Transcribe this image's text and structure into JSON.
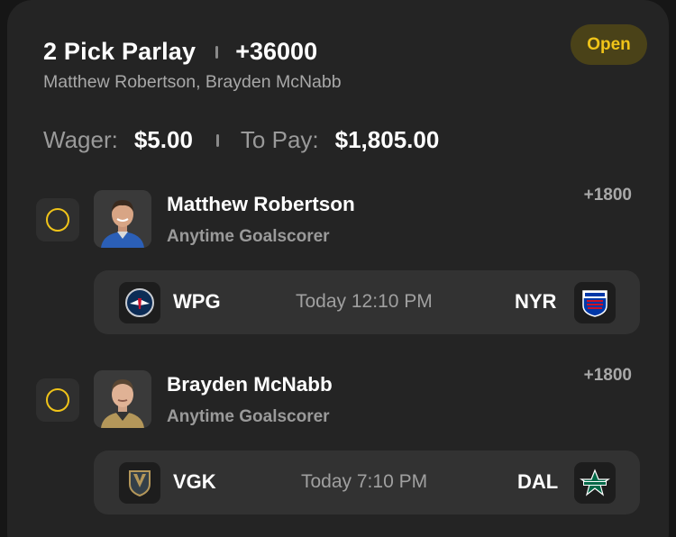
{
  "parlay": {
    "title": "2 Pick Parlay",
    "odds": "+36000",
    "players": "Matthew Robertson, Brayden McNabb",
    "status": "Open",
    "wager_label": "Wager:",
    "wager_value": "$5.00",
    "to_pay_label": "To Pay:",
    "to_pay_value": "$1,805.00"
  },
  "legs": [
    {
      "player": "Matthew Robertson",
      "market": "Anytime Goalscorer",
      "odds": "+1800",
      "game": {
        "away": "WPG",
        "time": "Today 12:10 PM",
        "home": "NYR",
        "away_logo": "jets-logo-icon",
        "home_logo": "rangers-logo-icon"
      }
    },
    {
      "player": "Brayden McNabb",
      "market": "Anytime Goalscorer",
      "odds": "+1800",
      "game": {
        "away": "VGK",
        "time": "Today 7:10 PM",
        "home": "DAL",
        "away_logo": "golden-knights-logo-icon",
        "home_logo": "stars-logo-icon"
      }
    }
  ],
  "colors": {
    "accent": "#f0c419",
    "card": "#242424",
    "game_box": "#323232",
    "muted_text": "#9a9a9a"
  }
}
